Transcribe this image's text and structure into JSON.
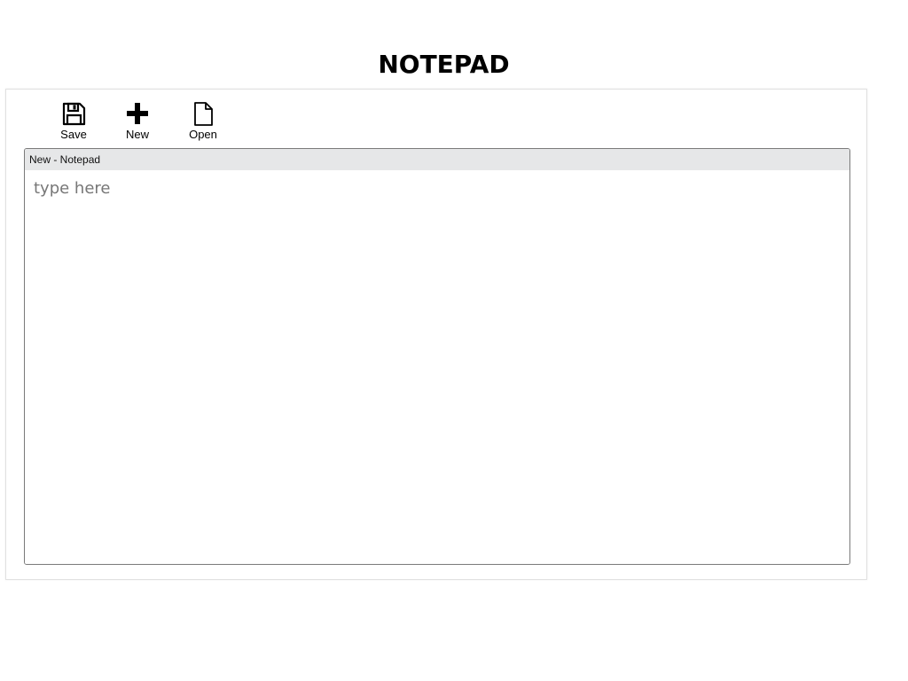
{
  "app": {
    "title": "NOTEPAD"
  },
  "toolbar": {
    "save_label": "Save",
    "save_icon": "floppy-disk-icon",
    "new_label": "New",
    "new_icon": "plus-icon",
    "open_label": "Open",
    "open_icon": "document-icon"
  },
  "editor": {
    "window_title": "New - Notepad",
    "placeholder": "type here",
    "value": ""
  },
  "colors": {
    "titlebar_bg": "#e6e7e8",
    "border": "#7a7a7a",
    "placeholder": "#777777"
  }
}
